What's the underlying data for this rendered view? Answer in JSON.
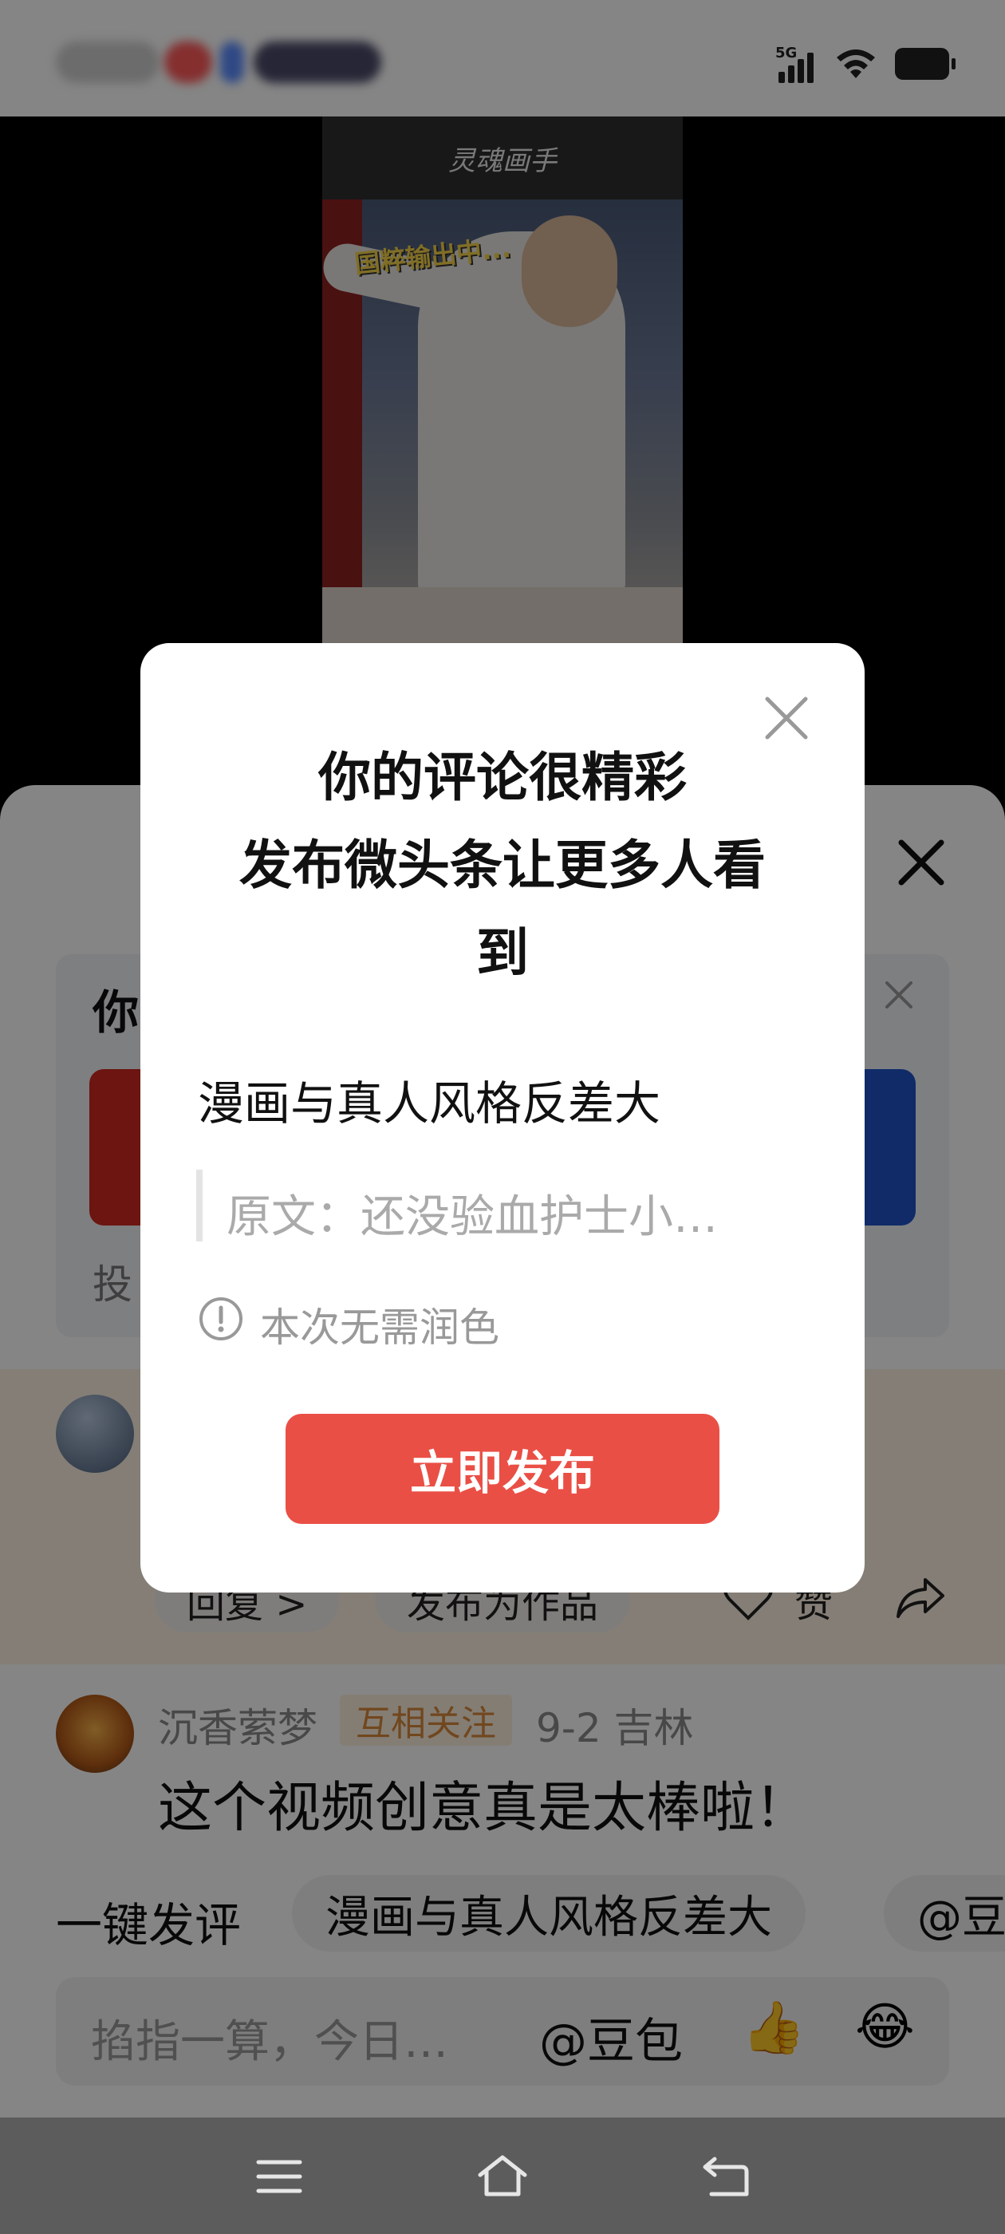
{
  "status_bar": {
    "network": "5G",
    "icons": [
      "signal-icon",
      "wifi-icon",
      "battery-icon"
    ]
  },
  "video": {
    "watermark": "灵魂画手",
    "caption": "国粹输出中..."
  },
  "panel": {
    "banner": {
      "title": "你",
      "subtitle": "投"
    },
    "reply_actions": {
      "reply": "回复 >",
      "publish_as_work": "发布为作品",
      "like": "赞"
    },
    "comment": {
      "user": "沉香萦梦",
      "badge": "互相关注",
      "meta": "9-2  吉林",
      "text": "这个视频创意真是太棒啦！"
    },
    "quick_comment": {
      "label": "一键发评",
      "chips": [
        "漫画与真人风格反差大",
        "@豆"
      ]
    },
    "input": {
      "placeholder": "掐指一算，今日…",
      "mention": "@豆包",
      "emoji": [
        "thumbs-up-icon",
        "laughing-icon"
      ]
    }
  },
  "modal": {
    "title_line1": "你的评论很精彩",
    "title_line2": "发布微头条让更多人看",
    "title_line3": "到",
    "comment_text": "漫画与真人风格反差大",
    "original": "原文：还没验血护士小…",
    "info": "本次无需润色",
    "publish_button": "立即发布"
  },
  "colors": {
    "accent_red": "#ea4f45",
    "badge_orange": "#d9883a",
    "overlay": "rgba(0,0,0,0.48)"
  }
}
